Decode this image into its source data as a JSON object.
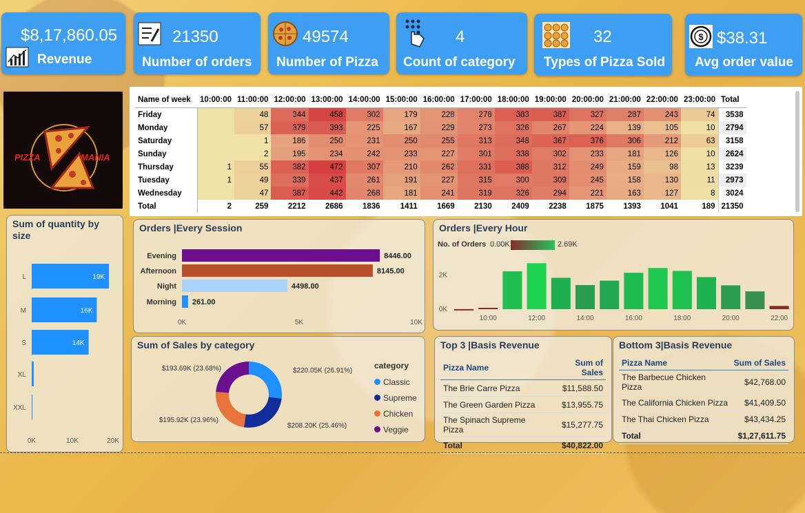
{
  "kpis": [
    {
      "value": "$8,17,860.05",
      "label": "Revenue",
      "icon": "growth-chart-icon"
    },
    {
      "value": "21350",
      "label": "Number of orders",
      "icon": "checklist-icon"
    },
    {
      "value": "49574",
      "label": "Number of Pizza",
      "icon": "pizza-icon"
    },
    {
      "value": "4",
      "label": "Count of category",
      "icon": "touch-grid-icon"
    },
    {
      "value": "32",
      "label": "Types of Pizza Sold",
      "icon": "pizza-types-icon"
    },
    {
      "value": "$38.31",
      "label": "Avg order value",
      "icon": "coin-icon"
    }
  ],
  "logo": {
    "text_left": "PIZZA",
    "text_right": "MANIA"
  },
  "matrix": {
    "corner": "Name of week",
    "hours": [
      "10:00:00",
      "11:00:00",
      "12:00:00",
      "13:00:00",
      "14:00:00",
      "15:00:00",
      "16:00:00",
      "17:00:00",
      "18:00:00",
      "19:00:00",
      "20:00:00",
      "21:00:00",
      "22:00:00",
      "23:00:00"
    ],
    "total_label": "Total",
    "rows": [
      {
        "day": "Friday",
        "vals": [
          "",
          "48",
          "344",
          "458",
          "302",
          "179",
          "228",
          "278",
          "383",
          "387",
          "327",
          "287",
          "243",
          "74"
        ],
        "total": "3538"
      },
      {
        "day": "Monday",
        "vals": [
          "",
          "57",
          "379",
          "393",
          "225",
          "167",
          "229",
          "273",
          "326",
          "267",
          "224",
          "139",
          "105",
          "10"
        ],
        "total": "2794"
      },
      {
        "day": "Saturday",
        "vals": [
          "",
          "1",
          "186",
          "250",
          "231",
          "250",
          "255",
          "313",
          "348",
          "367",
          "376",
          "306",
          "212",
          "63"
        ],
        "total": "3158"
      },
      {
        "day": "Sunday",
        "vals": [
          "",
          "2",
          "195",
          "234",
          "242",
          "233",
          "227",
          "301",
          "338",
          "302",
          "233",
          "181",
          "126",
          "10"
        ],
        "total": "2624"
      },
      {
        "day": "Thursday",
        "vals": [
          "1",
          "55",
          "382",
          "472",
          "307",
          "210",
          "262",
          "331",
          "388",
          "312",
          "249",
          "159",
          "98",
          "13"
        ],
        "total": "3239"
      },
      {
        "day": "Tuesday",
        "vals": [
          "1",
          "49",
          "339",
          "437",
          "261",
          "191",
          "227",
          "315",
          "300",
          "309",
          "245",
          "158",
          "130",
          "11"
        ],
        "total": "2973"
      },
      {
        "day": "Wednesday",
        "vals": [
          "",
          "47",
          "387",
          "442",
          "268",
          "181",
          "241",
          "319",
          "326",
          "294",
          "221",
          "163",
          "127",
          "8"
        ],
        "total": "3024"
      }
    ],
    "totals": {
      "label": "Total",
      "vals": [
        "2",
        "259",
        "2212",
        "2686",
        "1836",
        "1411",
        "1669",
        "2130",
        "2409",
        "2238",
        "1875",
        "1393",
        "1041",
        "189"
      ],
      "total": "21350"
    }
  },
  "size_chart": {
    "title": "Sum of quantity by size",
    "chart_data": {
      "type": "bar",
      "categories": [
        "L",
        "M",
        "S",
        "XL",
        "XXL"
      ],
      "values": [
        19000,
        16000,
        14000,
        500,
        30
      ],
      "labels": [
        "19K",
        "16K",
        "14K",
        "",
        ""
      ],
      "ticks": [
        "0K",
        "10K",
        "20K"
      ],
      "xlim": [
        0,
        20000
      ],
      "color": "#1e90ff"
    }
  },
  "session_chart": {
    "title": "Orders |Every Session",
    "chart_data": {
      "type": "bar",
      "categories": [
        "Evening",
        "Afternoon",
        "Night",
        "Morning"
      ],
      "values": [
        8446.0,
        8145.0,
        4498.0,
        261.0
      ],
      "labels": [
        "8446.00",
        "8145.00",
        "4498.00",
        "261.00"
      ],
      "colors": [
        "#6a0f8e",
        "#b5502a",
        "#a9d3fb",
        "#1e90ff"
      ],
      "ticks": [
        "0K",
        "5K",
        "10K"
      ],
      "xlim": [
        0,
        10000
      ]
    }
  },
  "hour_chart": {
    "title": "Orders |Every Hour",
    "legend_label": "No. of Orders",
    "legend_min": "0.00K",
    "legend_max": "2.69K",
    "chart_data": {
      "type": "bar",
      "categories": [
        "9",
        "10",
        "11",
        "12",
        "13",
        "14",
        "15",
        "16",
        "17",
        "18",
        "19",
        "20",
        "21",
        "22",
        "23"
      ],
      "values": [
        5,
        80,
        2212,
        2686,
        1836,
        1411,
        1669,
        2130,
        2409,
        2238,
        1875,
        1393,
        1041,
        189,
        90
      ],
      "ylim": [
        0,
        2900
      ],
      "yticks": [
        "0K",
        "2K"
      ],
      "xticks": [
        "10:00",
        "12:00",
        "14:00",
        "16:00",
        "18:00",
        "20:00",
        "22:00"
      ]
    }
  },
  "category_chart": {
    "title": "Sum of Sales by category",
    "legend_title": "category",
    "chart_data": {
      "type": "pie",
      "categories": [
        "Classic",
        "Supreme",
        "Chicken",
        "Veggie"
      ],
      "values": [
        220.05,
        208.2,
        195.92,
        193.69
      ],
      "labels": [
        "$220.05K (26.91%)",
        "$208.20K (25.46%)",
        "$195.92K (23.96%)",
        "$193.69K (23.68%)"
      ],
      "colors": [
        "#1e90ff",
        "#122e9a",
        "#e8743b",
        "#6a0f8e"
      ]
    }
  },
  "top3": {
    "title": "Top 3 |Basis Revenue",
    "headers": [
      "Pizza Name",
      "Sum of Sales"
    ],
    "rows": [
      [
        "The Brie Carre Pizza",
        "$11,588.50"
      ],
      [
        "The Green Garden Pizza",
        "$13,955.75"
      ],
      [
        "The Spinach Supreme Pizza",
        "$15,277.75"
      ]
    ],
    "total": [
      "Total",
      "$40,822.00"
    ]
  },
  "bottom3": {
    "title": "Bottom 3|Basis Revenue",
    "headers": [
      "Pizza Name",
      "Sum of Sales"
    ],
    "rows": [
      [
        "The Barbecue Chicken Pizza",
        "$42,768.00"
      ],
      [
        "The California Chicken Pizza",
        "$41,409.50"
      ],
      [
        "The Thai Chicken Pizza",
        "$43,434.25"
      ]
    ],
    "total": [
      "Total",
      "$1,27,611.75"
    ]
  }
}
